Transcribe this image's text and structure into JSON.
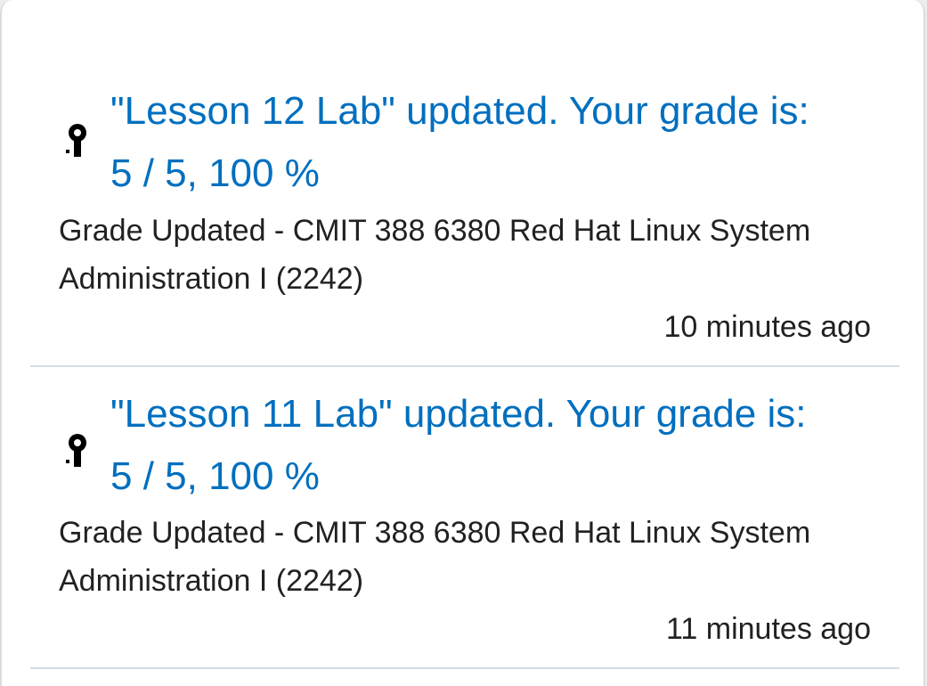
{
  "notifications": [
    {
      "title_line1": "\"Lesson 12 Lab\" updated. Your grade is:",
      "title_line2": "5 / 5, 100 %",
      "course_line1": "Grade Updated - CMIT 388 6380 Red Hat Linux System",
      "course_line2": "Administration I (2242)",
      "time": "10 minutes ago",
      "icon": "award-ribbon-icon"
    },
    {
      "title_line1": "\"Lesson 11 Lab\" updated. Your grade is:",
      "title_line2": "5 / 5, 100 %",
      "course_line1": "Grade Updated - CMIT 388 6380 Red Hat Linux System",
      "course_line2": "Administration I (2242)",
      "time": "11 minutes ago",
      "icon": "award-ribbon-icon"
    }
  ],
  "colors": {
    "link": "#006fbf",
    "text": "#202122",
    "divider": "#d3dde4"
  }
}
